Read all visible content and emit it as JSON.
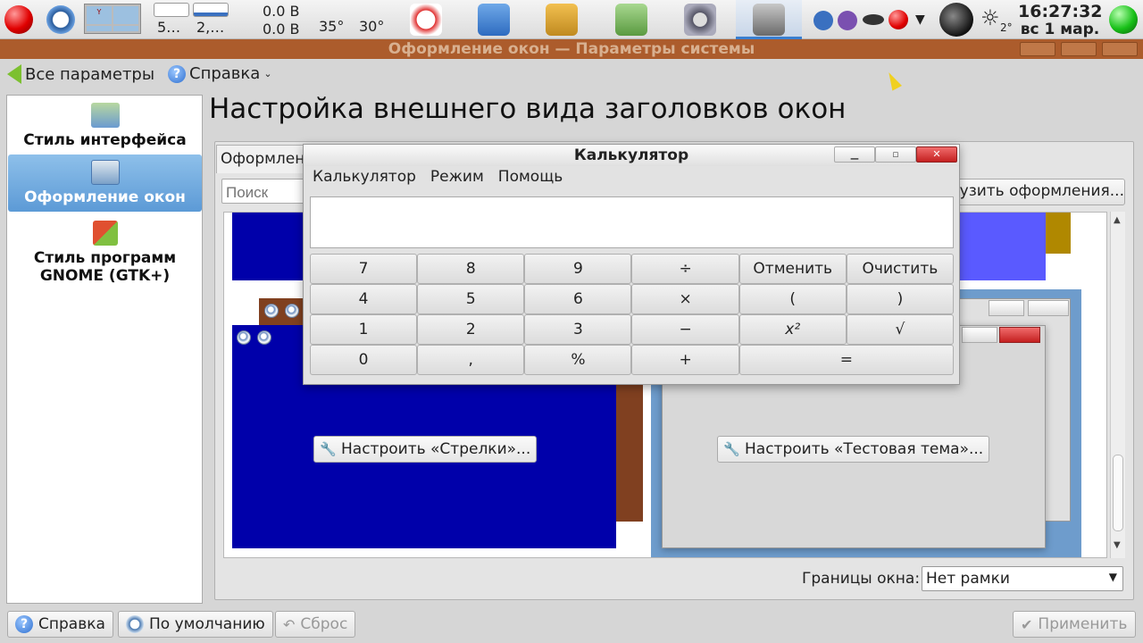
{
  "panel": {
    "net_mem_1": "5…",
    "net_mem_2": "2,…",
    "net_up": "0.0 B",
    "net_down": "0.0 B",
    "temp_1": "35°",
    "temp_2": "30°",
    "weather_temp": "2°",
    "time": "16:27:32",
    "date": "вс 1 мар."
  },
  "window": {
    "title": "Оформление окон — Параметры системы"
  },
  "toolbar": {
    "all_settings": "Все параметры",
    "help_menu": "Справка"
  },
  "sidebar": {
    "items": [
      {
        "label": "Стиль интерфейса"
      },
      {
        "label": "Оформление окон"
      },
      {
        "label": "Стиль программ GNOME (GTK+)"
      }
    ]
  },
  "main": {
    "title": "Настройка внешнего вида заголовков окон",
    "tab_label": "Оформление",
    "search_placeholder": "Поиск",
    "download_button": "Загрузить оформления...",
    "configure_arrows": "Настроить «Стрелки»...",
    "configure_test_theme": "Настроить «Тестовая тема»...",
    "border_label": "Границы окна:",
    "border_value": "Нет рамки"
  },
  "bottom": {
    "help": "Справка",
    "defaults": "По умолчанию",
    "reset": "Сброс",
    "apply": "Применить"
  },
  "calculator": {
    "title": "Калькулятор",
    "menu": [
      "Калькулятор",
      "Режим",
      "Помощь"
    ],
    "display": "",
    "keys": [
      "7",
      "8",
      "9",
      "÷",
      "Отменить",
      "Очистить",
      "4",
      "5",
      "6",
      "×",
      "(",
      ")",
      "1",
      "2",
      "3",
      "−",
      "x²",
      "√",
      "0",
      ",",
      "%",
      "+",
      "="
    ]
  },
  "colors": {
    "titlebar": "#ac5c2c",
    "preview_dark_blue": "#0000aa",
    "preview_brown": "#804020",
    "preview_light_blue": "#5a5aff",
    "preview_gold": "#b08800",
    "selection": "#6aa6dc"
  }
}
